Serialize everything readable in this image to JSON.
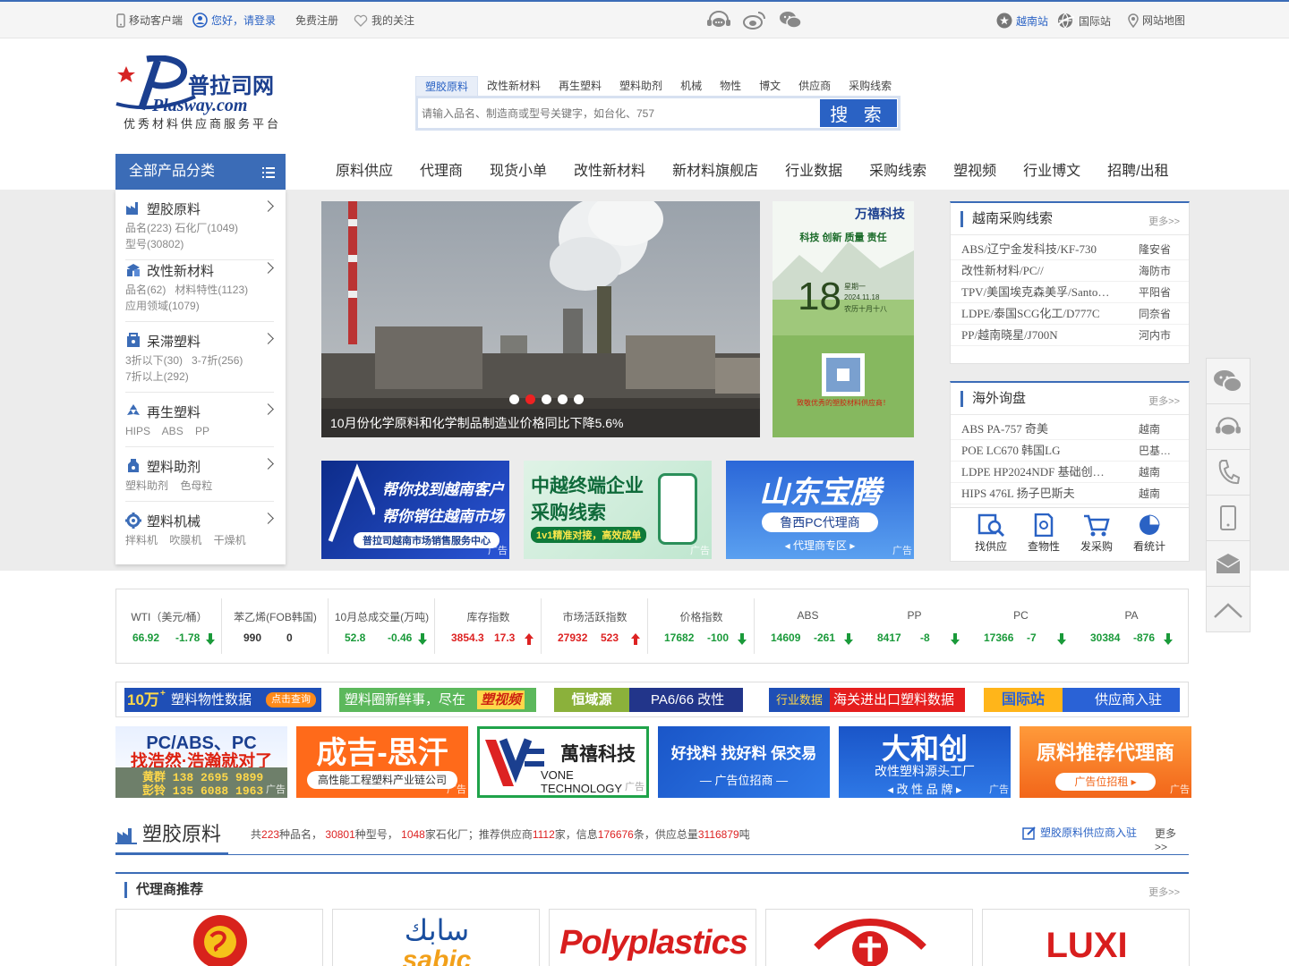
{
  "topbar": {
    "mobile": "移动客户端",
    "login": "您好，请登录",
    "register": "免费注册",
    "follow": "我的关注",
    "vietnam": "越南站",
    "intl": "国际站",
    "sitemap": "网站地图"
  },
  "logo": {
    "brand_cn": "普拉司网",
    "brand_en": "Plasway.com",
    "slogan": "优秀材料供应商服务平台"
  },
  "search": {
    "tabs": [
      "塑胶原料",
      "改性新材料",
      "再生塑料",
      "塑料助剂",
      "机械",
      "物性",
      "博文",
      "供应商",
      "采购线索"
    ],
    "placeholder": "请输入品名、制造商或型号关键字，如台化、757",
    "button": "搜 索"
  },
  "nav": {
    "category_btn": "全部产品分类",
    "items": [
      "原料供应",
      "代理商",
      "现货小单",
      "改性新材料",
      "新材料旗舰店",
      "行业数据",
      "采购线索",
      "塑视频",
      "行业博文",
      "招聘/出租"
    ]
  },
  "categories": [
    {
      "title": "塑胶原料",
      "sub": [
        "品名(223) 石化厂(1049)",
        "型号(30802)"
      ]
    },
    {
      "title": "改性新材料",
      "sub": [
        "品名(62)   材料特性(1123)",
        "应用领域(1079)"
      ]
    },
    {
      "title": "呆滞塑料",
      "sub": [
        "3折以下(30)   3-7折(256)",
        "7折以上(292)"
      ]
    },
    {
      "title": "再生塑料",
      "sub": [
        "HIPS    ABS    PP"
      ]
    },
    {
      "title": "塑料助剂",
      "sub": [
        "塑料助剂    色母粒"
      ]
    },
    {
      "title": "塑料机械",
      "sub": [
        "拌料机    吹膜机    干燥机"
      ]
    }
  ],
  "banner": {
    "caption": "10月份化学原料和化学制品制造业价格同比下降5.6%"
  },
  "vertical_ad": {
    "brand": "万禧科技",
    "slogan": "科技 创新 质量 责任",
    "day": "18",
    "weekday": "星期一",
    "date": "2024.11.18",
    "lunar": "农历十月十八",
    "footer": "致敬优秀的塑胶材料供应商！"
  },
  "mid_ads": [
    {
      "l1": "帮你找到越南客户",
      "l2": "帮你销往越南市场",
      "l3": "普拉司越南市场销售服务中心",
      "tag": "广告"
    },
    {
      "l1": "中越终端企业",
      "l2": "采购线索",
      "l3": "1v1精准对接，高效成单",
      "tag": "广告"
    },
    {
      "l1": "山东宝腾",
      "l2": "鲁西PC代理商",
      "l3": "◂ 代理商专区 ▸",
      "tag": "广告"
    }
  ],
  "vn_panel": {
    "title": "越南采购线索",
    "more": "更多>>",
    "rows": [
      [
        "ABS/辽宁金发科技/KF-730",
        "隆安省"
      ],
      [
        "改性新材料/PC//",
        "海防市"
      ],
      [
        "TPV/美国埃克森美孚/Santo…",
        "平阳省"
      ],
      [
        "LDPE/泰国SCG化工/D777C",
        "同奈省"
      ],
      [
        "PP/越南晓星/J700N",
        "河内市"
      ]
    ]
  },
  "ov_panel": {
    "title": "海外询盘",
    "more": "更多>>",
    "rows": [
      [
        "ABS PA-757 奇美",
        "越南"
      ],
      [
        "POE LC670 韩国LG",
        "巴基…"
      ],
      [
        "LDPE HP2024NDF 基础创…",
        "越南"
      ],
      [
        "HIPS 476L 扬子巴斯夫",
        "越南"
      ]
    ]
  },
  "tools": [
    "找供应",
    "查物性",
    "发采购",
    "看统计"
  ],
  "ticker": [
    {
      "name": "WTI（美元/桶）",
      "value": "66.92",
      "change": "-1.78",
      "dir": "down"
    },
    {
      "name": "苯乙烯(FOB韩国)",
      "value": "990",
      "change": "0",
      "dir": "none"
    },
    {
      "name": "10月总成交量(万吨)",
      "value": "52.8",
      "change": "-0.46",
      "dir": "down"
    },
    {
      "name": "库存指数",
      "value": "3854.3",
      "change": "17.3",
      "dir": "up"
    },
    {
      "name": "市场活跃指数",
      "value": "27932",
      "change": "523",
      "dir": "up"
    },
    {
      "name": "价格指数",
      "value": "17682",
      "change": "-100",
      "dir": "down"
    },
    {
      "name": "ABS",
      "value": "14609",
      "change": "-261",
      "dir": "down"
    },
    {
      "name": "PP",
      "value": "8417",
      "change": "-8",
      "dir": "down"
    },
    {
      "name": "PC",
      "value": "17366",
      "change": "-7",
      "dir": "down"
    },
    {
      "name": "PA",
      "value": "30384",
      "change": "-876",
      "dir": "down"
    }
  ],
  "strip": {
    "b1": {
      "big": "10万",
      "sup": "+",
      "text": "塑料物性数据",
      "btn": "点击查询"
    },
    "b2": {
      "text": "塑料圈新鲜事，尽在",
      "brand": "塑视频"
    },
    "b3": {
      "brand": "恒域源",
      "text": "PA6/66 改性"
    },
    "b4": {
      "left": "行业数据",
      "right": "海关进出口塑料数据"
    },
    "b5": {
      "left": "国际站",
      "right": "供应商入驻"
    }
  },
  "logo_ads": [
    {
      "l1": "PC/ABS、PC",
      "l2": "找浩然·浩瀚就对了",
      "l3": "黄群 138 2695 9899",
      "l4": "彭铃 135 6088 1963",
      "tag": "广告"
    },
    {
      "l1": "成吉-思汗",
      "l2": "高性能工程塑料产业链公司",
      "tag": "广告"
    },
    {
      "l1": "萬禧科技",
      "l2": "VONE TECHNOLOGY",
      "tag": "广告"
    },
    {
      "l1": "好找料 找好料 保交易",
      "l2": "— 广告位招商 —",
      "tag": "广告"
    },
    {
      "l1": "大和创",
      "l2": "改性塑料源头工厂",
      "l3": "◂ 改 性 品 牌 ▸",
      "tag": "广告"
    },
    {
      "l1": "原料推荐代理商",
      "l2": "广告位招租 ▸",
      "tag": "广告"
    }
  ],
  "section": {
    "title": "塑胶原料",
    "stats_pre": "共",
    "n1": "223",
    "t1": "种品名，",
    "n2": "30801",
    "t2": "种型号，",
    "n3": "1048",
    "t3": "家石化厂；推荐供应商",
    "n4": "1112",
    "t4": "家，信息",
    "n5": "176676",
    "t5": "条，供应总量",
    "n6": "3116879",
    "t6": "吨",
    "join": "塑胶原料供应商入驻",
    "more": "更多>>"
  },
  "agents": {
    "title": "代理商推荐",
    "more": "更多>>",
    "logos": [
      "",
      "sabic",
      "Polyplastics",
      "",
      "LUXI"
    ],
    "sabic_ar": "سابك"
  },
  "colors": {
    "primary": "#3b6cb7",
    "accent": "#2a62c4",
    "up": "#dd2222",
    "down": "#1a9a3a"
  }
}
